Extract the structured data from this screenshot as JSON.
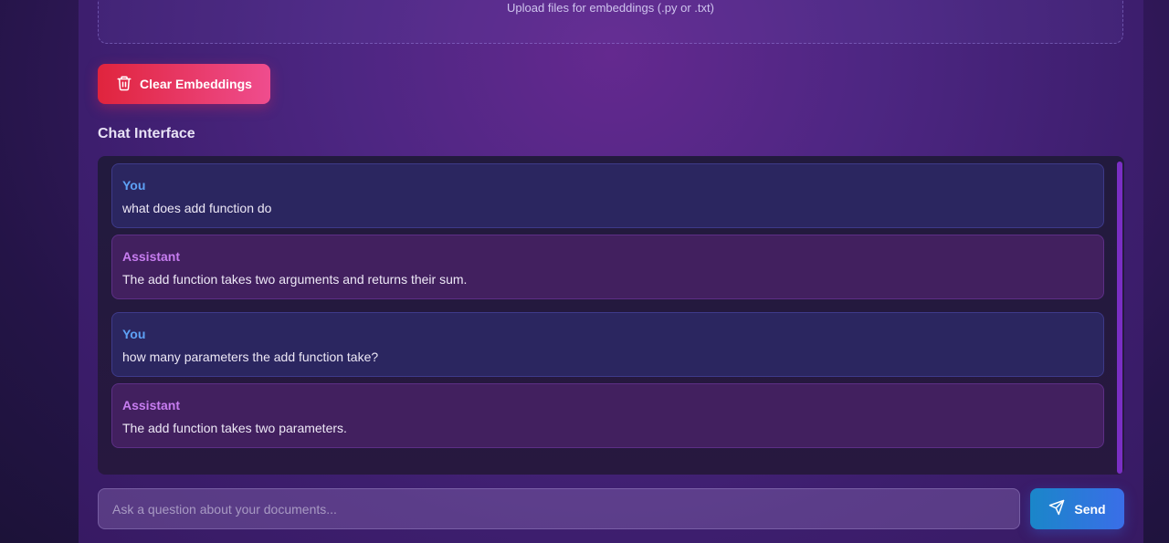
{
  "upload": {
    "hint": "Upload files for embeddings (.py or .txt)"
  },
  "clear_button": {
    "label": "Clear Embeddings",
    "icon": "trash-icon"
  },
  "chat": {
    "title": "Chat Interface",
    "messages": [
      {
        "role": "user",
        "sender": "You",
        "text": "what does add function do"
      },
      {
        "role": "assistant",
        "sender": "Assistant",
        "text": "The add function takes two arguments and returns their sum."
      },
      {
        "role": "user",
        "sender": "You",
        "text": "how many parameters the add function take?"
      },
      {
        "role": "assistant",
        "sender": "Assistant",
        "text": "The add function takes two parameters."
      }
    ]
  },
  "composer": {
    "placeholder": "Ask a question about your documents...",
    "value": "",
    "send_label": "Send",
    "send_icon": "send-icon"
  },
  "colors": {
    "clear_gradient": [
      "#e0243d",
      "#ef4d8e"
    ],
    "send_gradient": [
      "#1a86c9",
      "#3a6ee8"
    ],
    "user_sender": "#5ea1f5",
    "assistant_sender": "#c77df0"
  }
}
